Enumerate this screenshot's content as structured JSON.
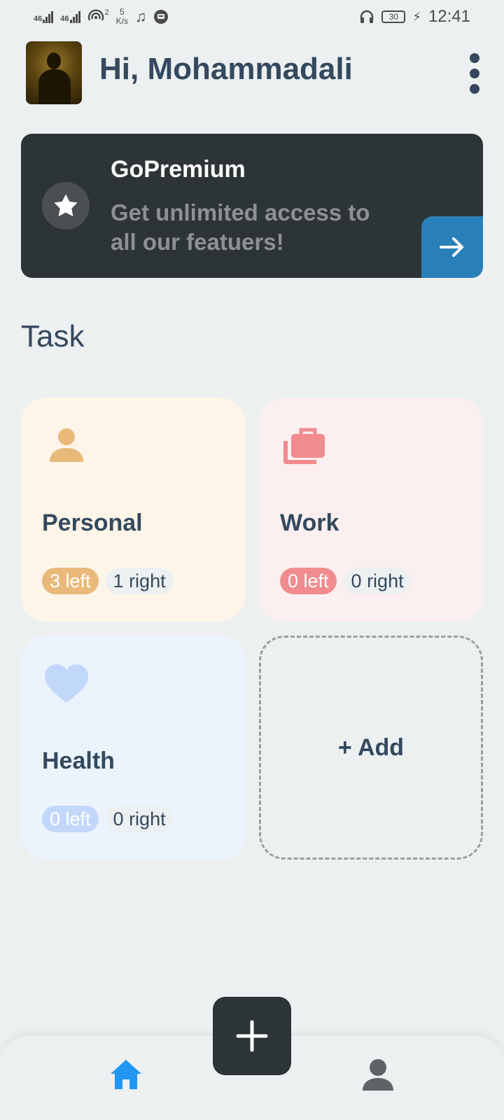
{
  "status_bar": {
    "signal1": "46",
    "signal2": "46",
    "hotspot_count": "2",
    "speed_value": "5",
    "speed_unit": "K/s",
    "battery": "30",
    "time": "12:41",
    "icons": [
      "signal-icon",
      "signal-icon",
      "hotspot-icon",
      "music-icon",
      "message-icon",
      "headset-icon",
      "battery-icon",
      "charging-icon"
    ]
  },
  "header": {
    "greeting": "Hi, Mohammadali",
    "menu_icon": "more-vertical-icon"
  },
  "premium": {
    "title": "GoPremium",
    "description": "Get unlimited access to all our featuers!",
    "icon": "star-icon",
    "action_icon": "arrow-right-icon",
    "colors": {
      "background": "#2d3436",
      "action": "#2980b9"
    }
  },
  "section": {
    "title": "Task"
  },
  "cards": [
    {
      "name": "Personal",
      "left": "3 left",
      "right": "1 right",
      "icon": "person-icon",
      "accent": "#e9b97a",
      "bg": "#fef5e9",
      "left_text_color": "#ffffff"
    },
    {
      "name": "Work",
      "left": "0 left",
      "right": "0 right",
      "icon": "briefcase-icon",
      "accent": "#f08b8e",
      "bg": "#fcefef",
      "left_text_color": "#ffffff"
    },
    {
      "name": "Health",
      "left": "0 left",
      "right": "0 right",
      "icon": "heart-icon",
      "accent": "#c2d8fb",
      "bg": "#ebf3fd",
      "left_text_color": "#ffffff"
    }
  ],
  "add_card": {
    "label": "+ Add"
  },
  "bottom_nav": {
    "items": [
      {
        "icon": "home-icon",
        "active": true,
        "color": "#2196f3"
      },
      {
        "icon": "profile-icon",
        "active": false,
        "color": "#5f6366"
      }
    ],
    "fab_icon": "plus-icon"
  }
}
